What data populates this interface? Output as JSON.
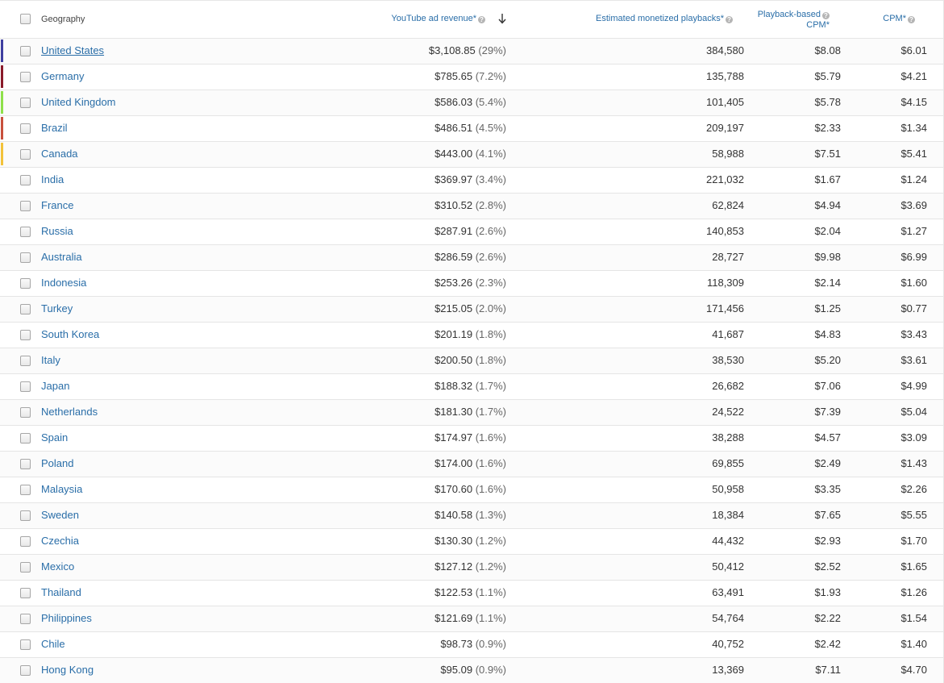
{
  "header": {
    "geography": "Geography",
    "revenue": "YouTube ad revenue*",
    "playbacks": "Estimated monetized playbacks*",
    "playback_cpm_line1": "Playback-based",
    "playback_cpm_line2": "CPM*",
    "cpm": "CPM*",
    "help_glyph": "?",
    "sort_icon": "arrow-down-icon"
  },
  "colors": {
    "link": "#2a6ea8",
    "united_states": "#3f3fa0",
    "germany": "#8a1a2a",
    "united_kingdom": "#8ee04a",
    "brazil": "#c8503c",
    "canada": "#f2c23a"
  },
  "rows": [
    {
      "geo": "United States",
      "revenue": "$3,108.85",
      "pct": "(29%)",
      "playbacks": "384,580",
      "pcpm": "$8.08",
      "cpm": "$6.01",
      "color": "#3f3fa0"
    },
    {
      "geo": "Germany",
      "revenue": "$785.65",
      "pct": "(7.2%)",
      "playbacks": "135,788",
      "pcpm": "$5.79",
      "cpm": "$4.21",
      "color": "#8a1a2a"
    },
    {
      "geo": "United Kingdom",
      "revenue": "$586.03",
      "pct": "(5.4%)",
      "playbacks": "101,405",
      "pcpm": "$5.78",
      "cpm": "$4.15",
      "color": "#8ee04a"
    },
    {
      "geo": "Brazil",
      "revenue": "$486.51",
      "pct": "(4.5%)",
      "playbacks": "209,197",
      "pcpm": "$2.33",
      "cpm": "$1.34",
      "color": "#c8503c"
    },
    {
      "geo": "Canada",
      "revenue": "$443.00",
      "pct": "(4.1%)",
      "playbacks": "58,988",
      "pcpm": "$7.51",
      "cpm": "$5.41",
      "color": "#f2c23a"
    },
    {
      "geo": "India",
      "revenue": "$369.97",
      "pct": "(3.4%)",
      "playbacks": "221,032",
      "pcpm": "$1.67",
      "cpm": "$1.24"
    },
    {
      "geo": "France",
      "revenue": "$310.52",
      "pct": "(2.8%)",
      "playbacks": "62,824",
      "pcpm": "$4.94",
      "cpm": "$3.69"
    },
    {
      "geo": "Russia",
      "revenue": "$287.91",
      "pct": "(2.6%)",
      "playbacks": "140,853",
      "pcpm": "$2.04",
      "cpm": "$1.27"
    },
    {
      "geo": "Australia",
      "revenue": "$286.59",
      "pct": "(2.6%)",
      "playbacks": "28,727",
      "pcpm": "$9.98",
      "cpm": "$6.99"
    },
    {
      "geo": "Indonesia",
      "revenue": "$253.26",
      "pct": "(2.3%)",
      "playbacks": "118,309",
      "pcpm": "$2.14",
      "cpm": "$1.60"
    },
    {
      "geo": "Turkey",
      "revenue": "$215.05",
      "pct": "(2.0%)",
      "playbacks": "171,456",
      "pcpm": "$1.25",
      "cpm": "$0.77"
    },
    {
      "geo": "South Korea",
      "revenue": "$201.19",
      "pct": "(1.8%)",
      "playbacks": "41,687",
      "pcpm": "$4.83",
      "cpm": "$3.43"
    },
    {
      "geo": "Italy",
      "revenue": "$200.50",
      "pct": "(1.8%)",
      "playbacks": "38,530",
      "pcpm": "$5.20",
      "cpm": "$3.61"
    },
    {
      "geo": "Japan",
      "revenue": "$188.32",
      "pct": "(1.7%)",
      "playbacks": "26,682",
      "pcpm": "$7.06",
      "cpm": "$4.99"
    },
    {
      "geo": "Netherlands",
      "revenue": "$181.30",
      "pct": "(1.7%)",
      "playbacks": "24,522",
      "pcpm": "$7.39",
      "cpm": "$5.04"
    },
    {
      "geo": "Spain",
      "revenue": "$174.97",
      "pct": "(1.6%)",
      "playbacks": "38,288",
      "pcpm": "$4.57",
      "cpm": "$3.09"
    },
    {
      "geo": "Poland",
      "revenue": "$174.00",
      "pct": "(1.6%)",
      "playbacks": "69,855",
      "pcpm": "$2.49",
      "cpm": "$1.43"
    },
    {
      "geo": "Malaysia",
      "revenue": "$170.60",
      "pct": "(1.6%)",
      "playbacks": "50,958",
      "pcpm": "$3.35",
      "cpm": "$2.26"
    },
    {
      "geo": "Sweden",
      "revenue": "$140.58",
      "pct": "(1.3%)",
      "playbacks": "18,384",
      "pcpm": "$7.65",
      "cpm": "$5.55"
    },
    {
      "geo": "Czechia",
      "revenue": "$130.30",
      "pct": "(1.2%)",
      "playbacks": "44,432",
      "pcpm": "$2.93",
      "cpm": "$1.70"
    },
    {
      "geo": "Mexico",
      "revenue": "$127.12",
      "pct": "(1.2%)",
      "playbacks": "50,412",
      "pcpm": "$2.52",
      "cpm": "$1.65"
    },
    {
      "geo": "Thailand",
      "revenue": "$122.53",
      "pct": "(1.1%)",
      "playbacks": "63,491",
      "pcpm": "$1.93",
      "cpm": "$1.26"
    },
    {
      "geo": "Philippines",
      "revenue": "$121.69",
      "pct": "(1.1%)",
      "playbacks": "54,764",
      "pcpm": "$2.22",
      "cpm": "$1.54"
    },
    {
      "geo": "Chile",
      "revenue": "$98.73",
      "pct": "(0.9%)",
      "playbacks": "40,752",
      "pcpm": "$2.42",
      "cpm": "$1.40"
    },
    {
      "geo": "Hong Kong",
      "revenue": "$95.09",
      "pct": "(0.9%)",
      "playbacks": "13,369",
      "pcpm": "$7.11",
      "cpm": "$4.70"
    }
  ]
}
